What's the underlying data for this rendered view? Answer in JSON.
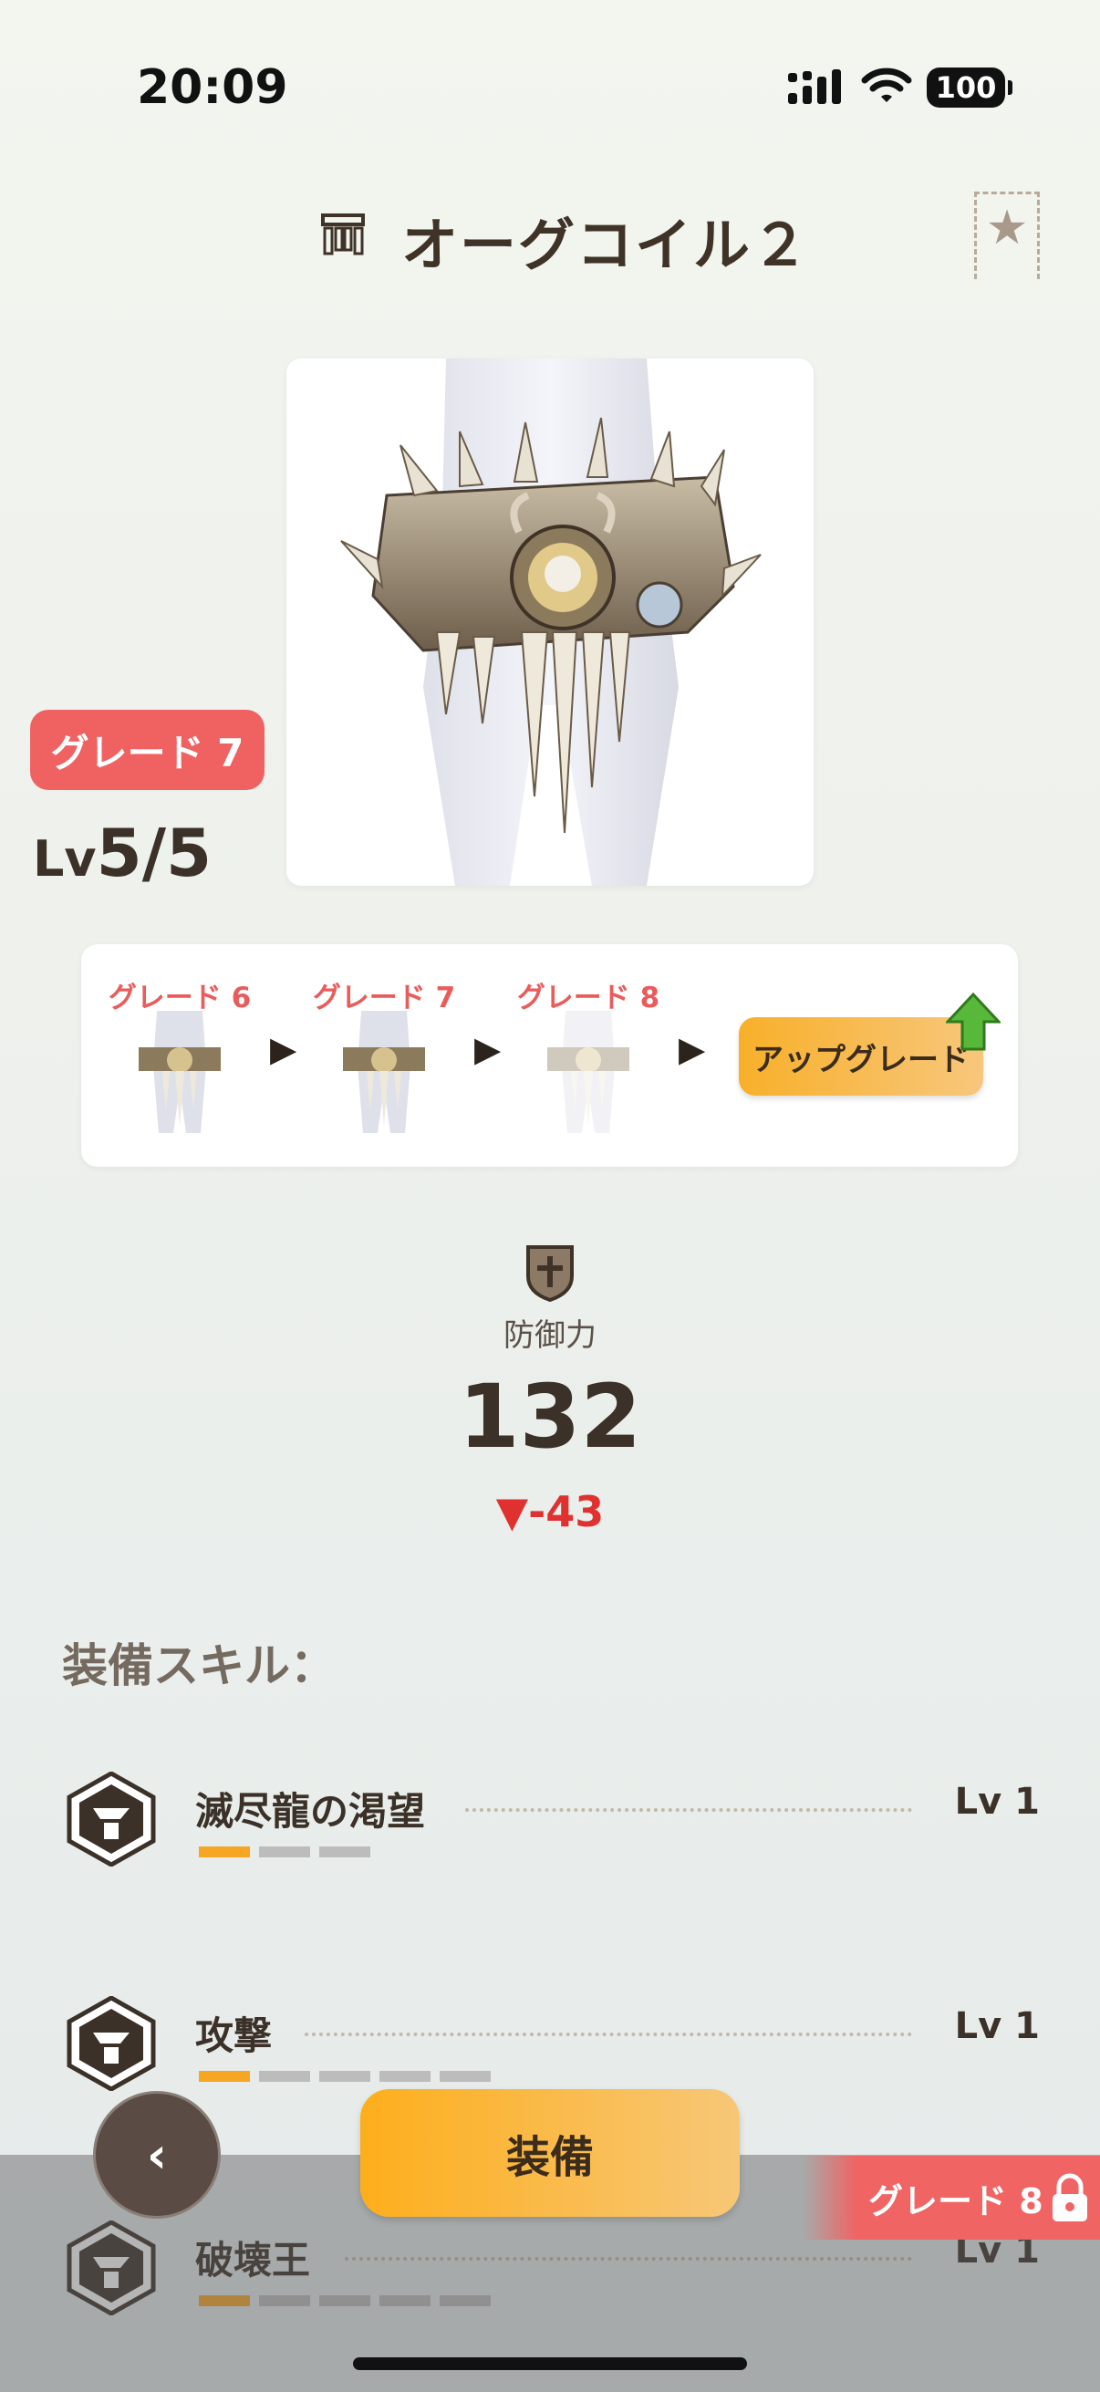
{
  "status_bar": {
    "time": "20:09",
    "battery": "100"
  },
  "header": {
    "title": "オーグコイル２",
    "slot_icon": "waist-armor-icon",
    "favorite_icon": "star-bookmark-icon"
  },
  "item": {
    "grade_badge": "グレード 7",
    "level_prefix": "Lv",
    "level_value": "5/5"
  },
  "upgrade": {
    "stages": [
      {
        "label": "グレード 6",
        "dimmed": false
      },
      {
        "label": "グレード 7",
        "dimmed": false
      },
      {
        "label": "グレード 8",
        "dimmed": true
      }
    ],
    "button_label": "アップグレード"
  },
  "stat": {
    "label": "防御力",
    "value": "132",
    "diff": "-43",
    "diff_icon": "down-triangle-icon"
  },
  "skills": {
    "heading": "装備スキル：",
    "items": [
      {
        "name": "滅尽龍の渇望",
        "level": "Lv 1",
        "filled": 1,
        "total": 3
      },
      {
        "name": "攻撃",
        "level": "Lv 1",
        "filled": 1,
        "total": 5
      },
      {
        "name": "破壊王",
        "level": "Lv 1",
        "filled": 1,
        "total": 5
      }
    ]
  },
  "footer": {
    "back_icon": "chevron-left-icon",
    "equip_label": "装備",
    "next_grade_label": "グレード 8"
  },
  "colors": {
    "accent_orange": "#f8b02a",
    "grade_red": "#f06262",
    "diff_red": "#e03131"
  }
}
